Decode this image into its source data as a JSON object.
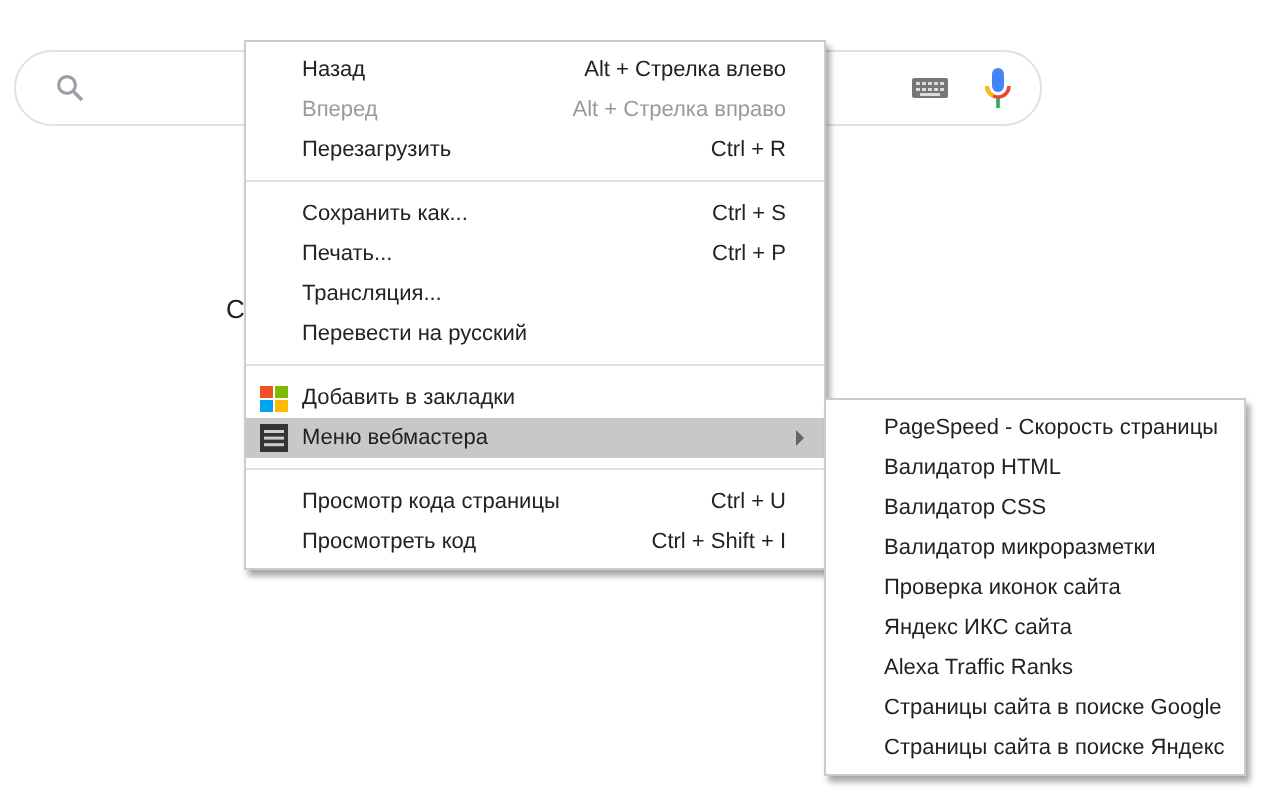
{
  "background_text": "С",
  "context_menu": {
    "items": [
      {
        "kind": "item",
        "label": "Назад",
        "shortcut": "Alt + Стрелка влево",
        "disabled": false,
        "selected": false
      },
      {
        "kind": "item",
        "label": "Вперед",
        "shortcut": "Alt + Стрелка вправо",
        "disabled": true,
        "selected": false
      },
      {
        "kind": "item",
        "label": "Перезагрузить",
        "shortcut": "Ctrl + R",
        "disabled": false,
        "selected": false
      },
      {
        "kind": "separator"
      },
      {
        "kind": "item",
        "label": "Сохранить как...",
        "shortcut": "Ctrl + S",
        "disabled": false,
        "selected": false
      },
      {
        "kind": "item",
        "label": "Печать...",
        "shortcut": "Ctrl + P",
        "disabled": false,
        "selected": false
      },
      {
        "kind": "item",
        "label": "Трансляция...",
        "disabled": false,
        "selected": false
      },
      {
        "kind": "item",
        "label": "Перевести на русский",
        "disabled": false,
        "selected": false
      },
      {
        "kind": "separator"
      },
      {
        "kind": "extension",
        "label": "Добавить в закладки",
        "disabled": false,
        "selected": false
      },
      {
        "kind": "submenu",
        "label": "Меню вебмастера",
        "disabled": false,
        "selected": true
      },
      {
        "kind": "separator"
      },
      {
        "kind": "item",
        "label": "Просмотр кода страницы",
        "shortcut": "Ctrl + U",
        "disabled": false,
        "selected": false
      },
      {
        "kind": "item",
        "label": "Просмотреть код",
        "shortcut": "Ctrl + Shift + I",
        "disabled": false,
        "selected": false
      }
    ]
  },
  "submenu": {
    "items": [
      {
        "label": "PageSpeed - Скорость страницы"
      },
      {
        "label": "Валидатор HTML"
      },
      {
        "label": "Валидатор CSS"
      },
      {
        "label": "Валидатор микроразметки"
      },
      {
        "label": "Проверка иконок сайта"
      },
      {
        "label": "Яндекс ИКС сайта"
      },
      {
        "label": "Alexa Traffic Ranks"
      },
      {
        "label": "Страницы сайта в поиске Google"
      },
      {
        "label": "Страницы сайта в поиске Яндекс"
      }
    ]
  }
}
